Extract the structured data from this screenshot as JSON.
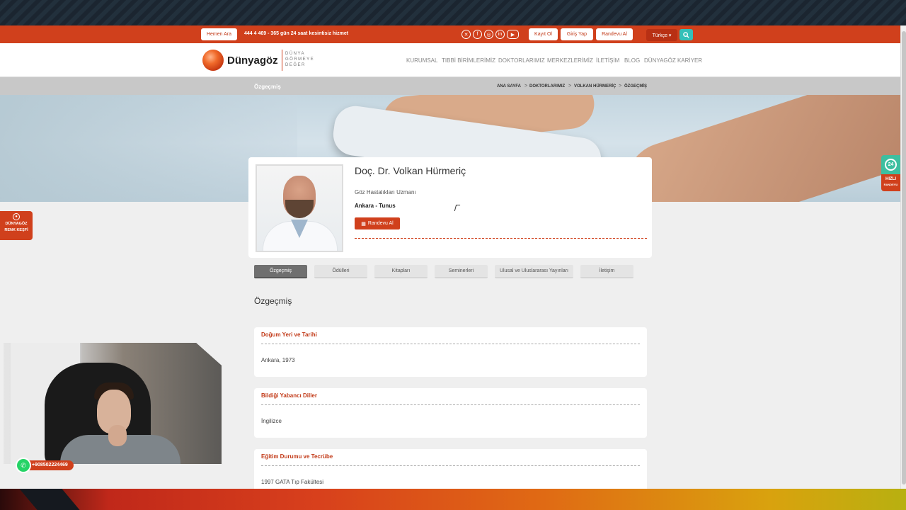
{
  "topbar": {
    "call_button": "Hemen Ara",
    "hotline": "444 4 469 - 365 gün 24 saat kesintisiz hizmet",
    "social_icons": [
      "x-icon",
      "facebook-icon",
      "instagram-icon",
      "linkedin-icon",
      "youtube-icon"
    ],
    "register": "Kayıt Ol",
    "login": "Giriş Yap",
    "appointment": "Randevu Al",
    "language": "Türkçe ▾"
  },
  "header": {
    "logo": "Dünyagöz",
    "tagline": "DÜNYA GÖRMEYE DEĞER",
    "nav": [
      "KURUMSAL",
      "TIBBİ BİRİMLERİMİZ",
      "DOKTORLARIMIZ",
      "MERKEZLERİMİZ",
      "İLETİŞİM",
      "BLOG",
      "DÜNYAGÖZ KARİYER"
    ]
  },
  "breadcrumb": {
    "title": "Özgeçmiş",
    "items": [
      "ANA SAYFA",
      "DOKTORLARIMIZ",
      "VOLKAN HÜRMERİÇ",
      "ÖZGEÇMİŞ"
    ],
    "separator": ">"
  },
  "doctor": {
    "name": "Doç. Dr. Volkan Hürmeriç",
    "specialty": "Göz Hastalıkları Uzmanı",
    "location": "Ankara - Tunus",
    "appointment_button": "Randevu Al"
  },
  "tabs": [
    "Özgeçmiş",
    "Ödülleri",
    "Kitapları",
    "Seminerleri",
    "Ulusal ve Uluslararası Yayınları",
    "İletişim"
  ],
  "section_title": "Özgeçmiş",
  "info_cards": [
    {
      "title": "Doğum Yeri ve Tarihi",
      "value": "Ankara, 1973"
    },
    {
      "title": "Bildiği Yabancı Diller",
      "value": "İngilizce"
    },
    {
      "title": "Eğitim Durumu ve Tecrübe",
      "value": "1997 GATA Tıp Fakültesi"
    }
  ],
  "floating": {
    "color_test_line1": "DÜNYAGÖZ",
    "color_test_line2": "RENK KEŞFİ",
    "quick_badge_number": "24",
    "quick_badge_line1": "HIZLI",
    "quick_badge_line2": "RANDEVU",
    "whatsapp_number": "+908502224469"
  },
  "colors": {
    "brand_orange": "#d0401c",
    "accent_teal": "#34c0b8",
    "whatsapp_green": "#25d366"
  }
}
